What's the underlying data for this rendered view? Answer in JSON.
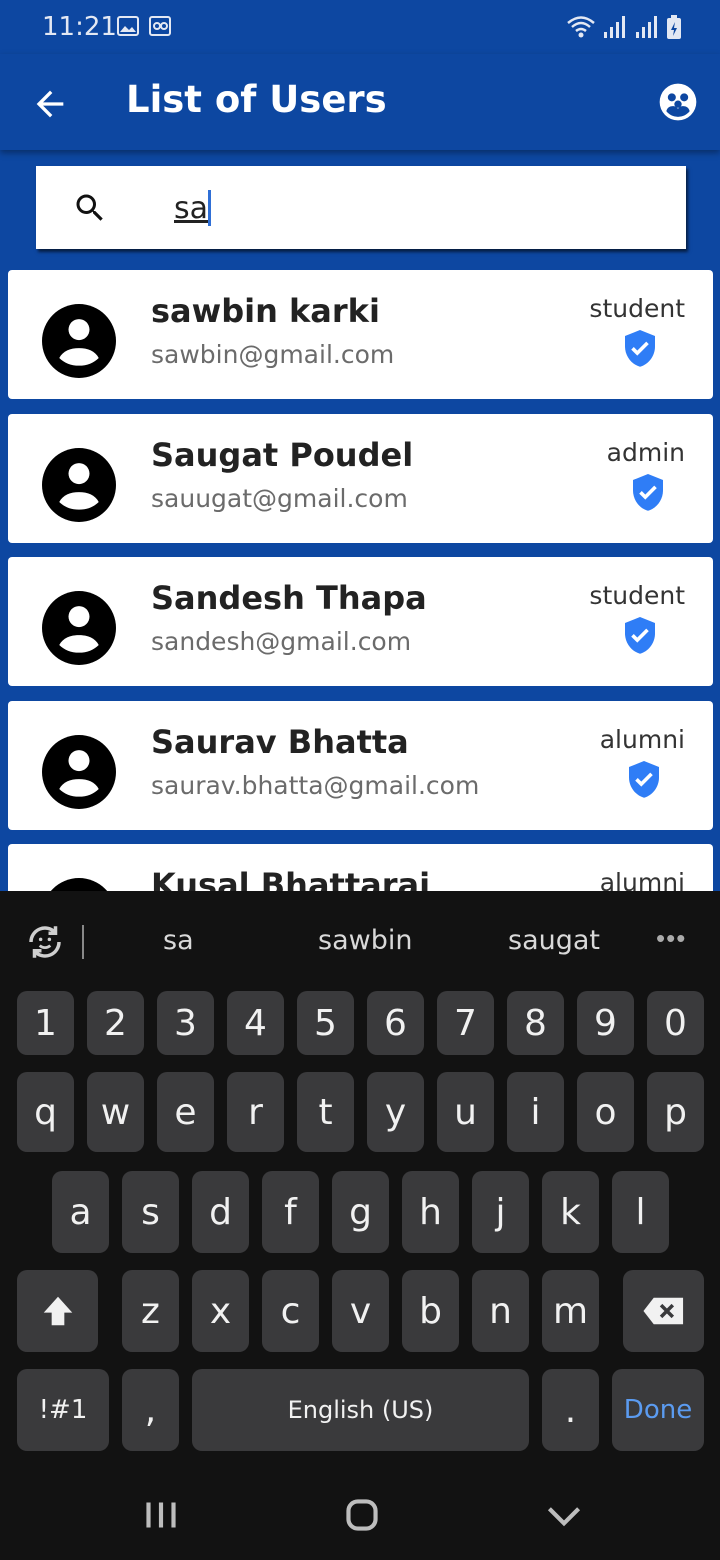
{
  "status_bar": {
    "time": "11:21"
  },
  "app_bar": {
    "title": "List of Users"
  },
  "search": {
    "value": "sa"
  },
  "users": [
    {
      "name": "sawbin karki",
      "email": "sawbin@gmail.com",
      "role": "student"
    },
    {
      "name": "Saugat Poudel",
      "email": "sauugat@gmail.com",
      "role": "admin"
    },
    {
      "name": "Sandesh Thapa",
      "email": "sandesh@gmail.com",
      "role": "student"
    },
    {
      "name": "Saurav Bhatta",
      "email": "saurav.bhatta@gmail.com",
      "role": "alumni"
    },
    {
      "name": "Kusal Bhattarai",
      "email": "",
      "role": "alumni"
    }
  ],
  "keyboard": {
    "suggestions": [
      "sa",
      "sawbin",
      "saugat"
    ],
    "row_numbers": [
      "1",
      "2",
      "3",
      "4",
      "5",
      "6",
      "7",
      "8",
      "9",
      "0"
    ],
    "row_top": [
      "q",
      "w",
      "e",
      "r",
      "t",
      "y",
      "u",
      "i",
      "o",
      "p"
    ],
    "row_mid": [
      "a",
      "s",
      "d",
      "f",
      "g",
      "h",
      "j",
      "k",
      "l"
    ],
    "row_bottom": [
      "z",
      "x",
      "c",
      "v",
      "b",
      "n",
      "m"
    ],
    "symbols_label": "!#1",
    "comma_label": ",",
    "space_label": "English (US)",
    "period_label": ".",
    "done_label": "Done"
  },
  "colors": {
    "primary": "#0d47a1",
    "verified": "#2f7df6",
    "keyboard_bg": "#121212",
    "key_bg": "#3a3a3c",
    "done": "#5b9bf0"
  },
  "icons": {
    "back": "arrow-left-icon",
    "group": "group-icon",
    "search": "search-icon",
    "avatar": "account-circle-icon",
    "verified": "verified-shield-icon"
  }
}
